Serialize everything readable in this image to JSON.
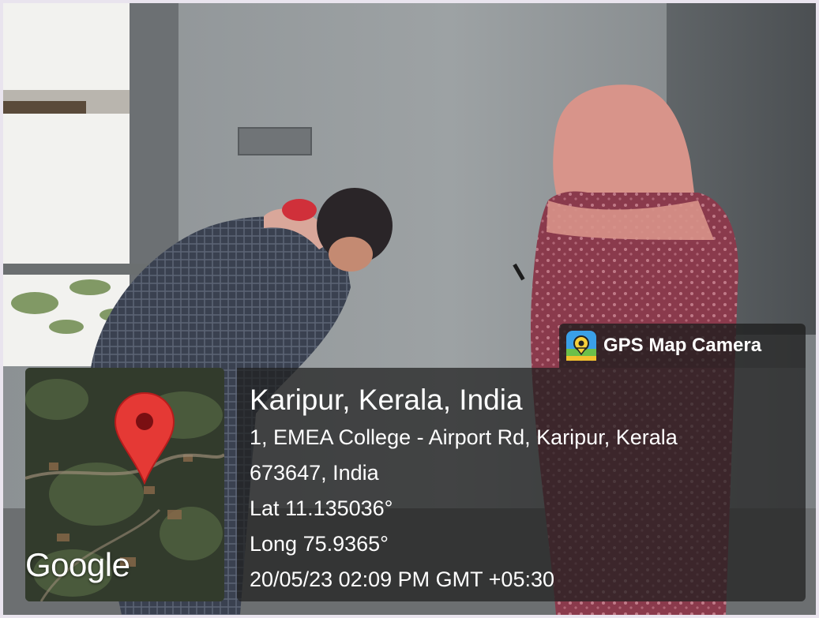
{
  "badge": {
    "icon": "gps-map-camera-app-icon",
    "label": "GPS Map Camera"
  },
  "map": {
    "icon": "map-pin-icon",
    "brand": "Google"
  },
  "location": {
    "title": "Karipur, Kerala, India",
    "address_line1": "1, EMEA College - Airport Rd, Karipur, Kerala",
    "address_line2": "673647, India",
    "latitude": "Lat 11.135036°",
    "longitude": "Long 75.9365°",
    "datetime": "20/05/23 02:09 PM GMT +05:30"
  },
  "colors": {
    "pin": "#e53935",
    "panel": "#1e1e1e"
  }
}
